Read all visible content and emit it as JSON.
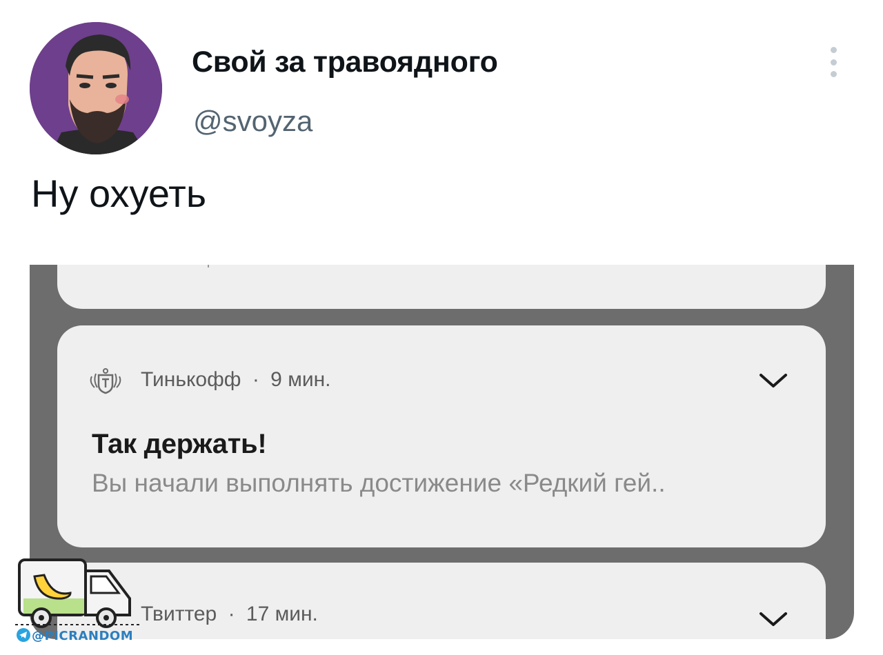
{
  "tweet": {
    "display_name": "Свой за травоядного",
    "handle": "@svoyza",
    "text": "Ну охуеть"
  },
  "notifications": [
    {
      "app": "Тинькофф",
      "time": "9 мин.",
      "title": "Так держать!",
      "body": "Вы начали выполнять достижение «Редкий гей.."
    },
    {
      "app": "Твиттер",
      "time": "17 мин."
    }
  ],
  "separator": "·",
  "watermark": {
    "text": "@PICRANDOM"
  },
  "icons": {
    "more": "more-vertical-icon",
    "expand": "chevron-down-icon",
    "tinkoff": "tinkoff-logo-icon",
    "telegram": "telegram-icon"
  },
  "colors": {
    "name": "#0f1419",
    "handle": "#536471",
    "avatar_bg": "#6e3f8c",
    "media_bg": "#6d6d6d",
    "card_bg": "#efefef",
    "notif_body": "#8a8a8a"
  }
}
